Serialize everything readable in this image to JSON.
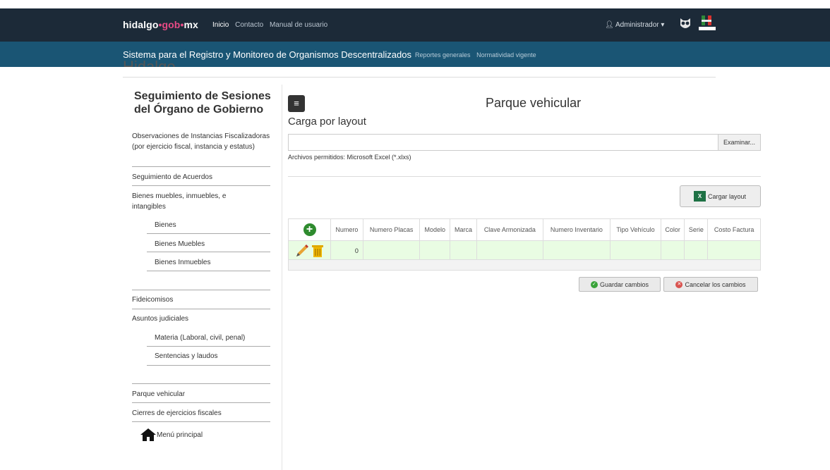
{
  "topbar": {
    "brand": {
      "part1": "hidalgo",
      "sep1": "•",
      "part2": "gob",
      "sep2": "•",
      "part3": "mx"
    },
    "nav": [
      "Inicio",
      "Contacto",
      "Manual de usuario"
    ],
    "user": "Administrador"
  },
  "subbar": {
    "title": "Sistema para el Registro y Monitoreo de Organismos Descentralizados",
    "links": [
      "Reportes generales",
      "Normatividad vigente"
    ]
  },
  "cut_heading": "Hidalgo",
  "sidebar": {
    "title": "Seguimiento de Sesiones del Órgano de Gobierno",
    "items": {
      "observaciones": "Observaciones de Instancias Fiscalizadoras (por ejercicio fiscal, instancia y estatus)",
      "acuerdos": "Seguimiento de Acuerdos",
      "bienes_group": "Bienes muebles, inmuebles, e intangibles",
      "bienes": "Bienes",
      "bienes_muebles": "Bienes Muebles",
      "bienes_inmuebles": "Bienes Inmuebles",
      "fideicomisos": "Fideicomisos",
      "asuntos": "Asuntos judiciales",
      "materia": "Materia (Laboral, civil, penal)",
      "sentencias": "Sentencias y laudos",
      "parque": "Parque vehicular",
      "cierres": "Cierres de ejercicios fiscales",
      "menu_principal": "Menú principal"
    }
  },
  "main": {
    "menu_glyph": "≡",
    "title": "Parque vehicular",
    "section": "Carga por layout",
    "browse": "Examinar...",
    "allowed": "Archivos permitidos: Microsoft Excel (*.xlxs)",
    "load_button": "Cargar layout",
    "table": {
      "columns": [
        "Numero",
        "Numero Placas",
        "Modelo",
        "Marca",
        "Clave Armonizada",
        "Numero Inventario",
        "Tipo Vehículo",
        "Color",
        "Serie",
        "Costo Factura"
      ],
      "row": {
        "numero": "0"
      }
    },
    "save": "Guardar cambios",
    "cancel": "Cancelar los cambios"
  }
}
